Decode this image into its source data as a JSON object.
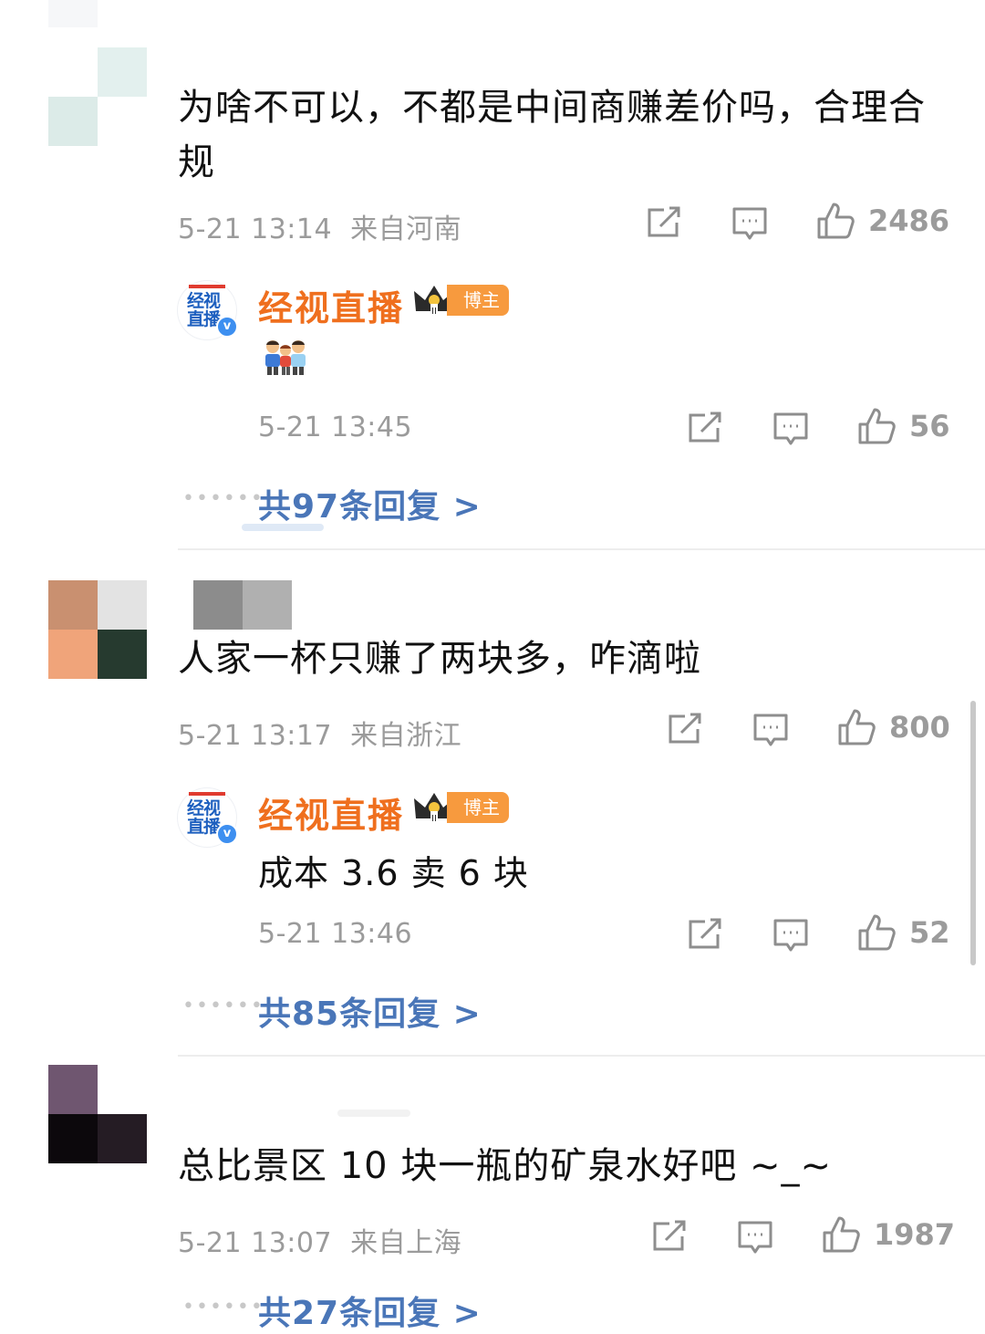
{
  "comments": [
    {
      "text": "为啥不可以，不都是中间商赚差价吗，合理合规",
      "time": "5-21 13:14",
      "location": "来自河南",
      "likes": "2486",
      "author_reply": {
        "author": "经视直播",
        "badge": "博主",
        "avatar_text": "经视直播",
        "text": "👨‍👩‍👦",
        "time": "5-21 13:45",
        "likes": "56"
      },
      "reply_summary": "共97条回复 >"
    },
    {
      "text": "人家一杯只赚了两块多，咋滴啦",
      "time": "5-21 13:17",
      "location": "来自浙江",
      "likes": "800",
      "author_reply": {
        "author": "经视直播",
        "badge": "博主",
        "avatar_text": "经视直播",
        "text": "成本 3.6 卖 6 块",
        "time": "5-21 13:46",
        "likes": "52"
      },
      "reply_summary": "共85条回复 >"
    },
    {
      "text": "总比景区 10 块一瓶的矿泉水好吧 ~_~",
      "time": "5-21 13:07",
      "location": "来自上海",
      "likes": "1987",
      "reply_summary": "共27条回复 >"
    }
  ],
  "icons": {
    "share": "share-icon",
    "comment": "comment-icon",
    "like": "thumbs-up-icon",
    "crown": "crown-icon",
    "verified": "verified-icon"
  },
  "colors": {
    "author_name": "#ef6f1e",
    "badge": "#f79a3e",
    "link": "#4a76b8",
    "meta": "#9b9b9b"
  }
}
